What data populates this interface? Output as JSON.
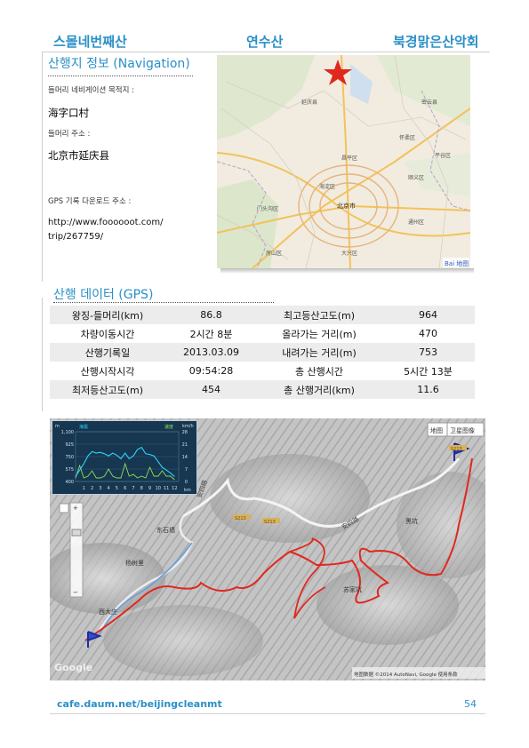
{
  "header": {
    "left": "스몰네번째산",
    "center": "연수산",
    "right": "북경맑은산악회"
  },
  "navigation": {
    "title": "산행지 정보 (Navigation)",
    "dest_label": "들머리 네비게이션 목적지 :",
    "dest_value": "海字口村",
    "addr_label": "들머리 주소 :",
    "addr_value": "北京市延庆县",
    "gps_label": "GPS 기록 다운로드 주소 :",
    "gps_url_1": "http://www.foooooot.com/",
    "gps_url_2": "trip/267759/"
  },
  "location_map": {
    "labels": [
      "北京市",
      "延庆县",
      "怀柔区",
      "顺义区",
      "海淀区",
      "昌平区",
      "门头沟区",
      "房山区",
      "大兴区",
      "通州区",
      "平谷区",
      "密云县"
    ],
    "logo": "Bai 地图",
    "marker_color": "#e0281f"
  },
  "gps": {
    "title": "산행 데이터 (GPS)",
    "rows": [
      {
        "k1": "왕징-들머리(km)",
        "v1": "86.8",
        "k2": "최고등산고도(m)",
        "v2": "964"
      },
      {
        "k1": "차량이동시간",
        "v1": "2시간 8분",
        "k2": "올라가는 거리(m)",
        "v2": "470"
      },
      {
        "k1": "산행기록일",
        "v1": "2013.03.09",
        "k2": "내려가는 거리(m)",
        "v2": "753"
      },
      {
        "k1": "산행시작시각",
        "v1": "09:54:28",
        "k2": "총 산행시간",
        "v2": "5시간 13분"
      },
      {
        "k1": "최저등산고도(m)",
        "v1": "454",
        "k2": "총 산행거리(km)",
        "v2": "11.6"
      }
    ]
  },
  "terrain_map": {
    "btn_map": "地图",
    "btn_satellite": "卫星图像",
    "road_label_1": "S213",
    "road_label_2": "S213",
    "road_label_3": "S213",
    "road_name_1": "安四路",
    "road_name_2": "安四路",
    "place_1": "东石墙",
    "place_2": "杨树里",
    "place_3": "西大庄",
    "place_4": "苏家坑",
    "place_5": "黑坑",
    "attribution": "地图数据 ©2014 AutoNavi, Google   使用条款",
    "google": "Google",
    "zoom_plus": "+",
    "zoom_minus": "−",
    "route_color": "#e0281f"
  },
  "profile_chart": {
    "unit_left": "m",
    "unit_right": "km/h",
    "legend_left": "海拔",
    "legend_right": "速度",
    "y_left_ticks": [
      "1,100",
      "925",
      "750",
      "575",
      "400"
    ],
    "y_right_ticks": [
      "28",
      "21",
      "14",
      "7",
      "0"
    ],
    "x_ticks": [
      "1",
      "2",
      "3",
      "4",
      "5",
      "6",
      "7",
      "8",
      "9",
      "10",
      "11",
      "12"
    ],
    "x_unit": "km"
  },
  "chart_data": {
    "type": "line",
    "x": [
      0,
      0.5,
      1,
      1.5,
      2,
      2.5,
      3,
      3.5,
      4,
      4.5,
      5,
      5.5,
      6,
      6.5,
      7,
      7.5,
      8,
      8.5,
      9,
      9.5,
      10,
      10.5,
      11,
      11.5,
      12
    ],
    "series": [
      {
        "name": "海拔",
        "axis": "left",
        "values": [
          470,
          560,
          650,
          760,
          820,
          800,
          810,
          790,
          760,
          800,
          770,
          720,
          800,
          720,
          760,
          850,
          880,
          790,
          780,
          760,
          680,
          600,
          560,
          520,
          470
        ]
      },
      {
        "name": "速度",
        "axis": "right",
        "values": [
          2,
          9,
          2,
          3,
          6,
          2,
          2,
          3,
          7,
          3,
          2,
          2,
          10,
          3,
          4,
          2,
          3,
          2,
          8,
          3,
          3,
          6,
          3,
          3,
          1
        ]
      }
    ],
    "ylim_left": [
      400,
      1100
    ],
    "ylim_right": [
      0,
      28
    ],
    "xlim": [
      0,
      12.5
    ],
    "grid": true
  },
  "footer": {
    "url": "cafe.daum.net/beijingcleanmt",
    "page": "54"
  }
}
